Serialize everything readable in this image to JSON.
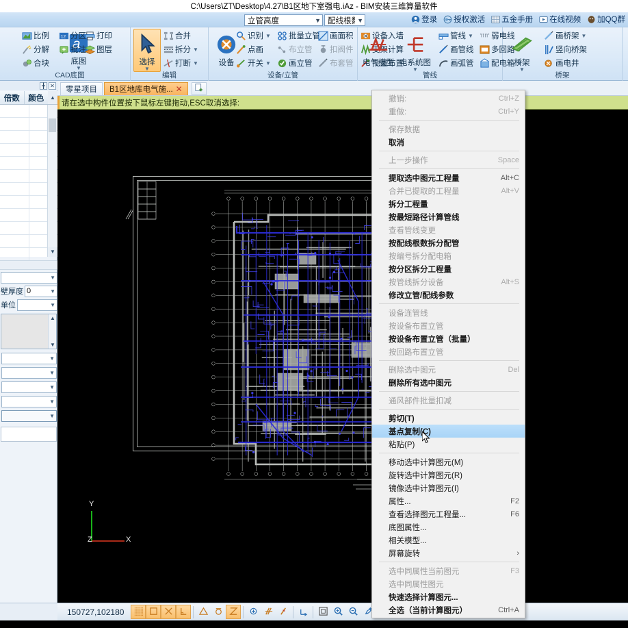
{
  "window": {
    "title": "C:\\Users\\ZT\\Desktop\\4.27\\B1区地下室强电.iAz - BIM安装三维算量软件"
  },
  "topbar": {
    "combos": [
      {
        "name": "pipe-height",
        "value": "立管高度"
      },
      {
        "name": "wire-count",
        "value": "配线根数"
      }
    ],
    "links": [
      {
        "icon": "user-icon",
        "label": "登录"
      },
      {
        "icon": "key-icon",
        "label": "授权激活"
      },
      {
        "icon": "book-icon",
        "label": "五金手册"
      },
      {
        "icon": "video-icon",
        "label": "在线视频"
      },
      {
        "icon": "qq-icon",
        "label": "加QQ群"
      }
    ]
  },
  "ribbon": {
    "groups": [
      {
        "name": "cad-base",
        "label": "CAD底图",
        "items": [
          {
            "label": "比例",
            "icon": "scale-icon",
            "dropdown": false,
            "disabled": false
          },
          {
            "label": "分区",
            "icon": "zone-icon",
            "dropdown": true,
            "disabled": false
          },
          {
            "label": "分解",
            "icon": "explode-icon",
            "dropdown": false,
            "disabled": false
          },
          {
            "label": "批注",
            "icon": "note-icon",
            "dropdown": true,
            "disabled": false
          },
          {
            "label": "合块",
            "icon": "merge-icon",
            "dropdown": false,
            "disabled": false
          },
          {
            "label": "打印",
            "icon": "print-icon",
            "dropdown": false,
            "disabled": false
          },
          {
            "label": "图层",
            "icon": "layer-icon",
            "dropdown": false,
            "disabled": false
          }
        ],
        "bigbuttons": [
          {
            "label": "底图",
            "icon": "basemap-icon",
            "dropdown": true,
            "selected": false
          }
        ]
      },
      {
        "name": "edit",
        "label": "编辑",
        "items": [
          {
            "label": "合并",
            "icon": "combine-icon",
            "dropdown": false,
            "disabled": false
          },
          {
            "label": "拆分",
            "icon": "split-icon",
            "dropdown": true,
            "disabled": false
          },
          {
            "label": "打断",
            "icon": "break-icon",
            "dropdown": true,
            "disabled": false
          }
        ],
        "bigbuttons": [
          {
            "label": "选择",
            "icon": "select-arrow-icon",
            "dropdown": true,
            "selected": true
          }
        ]
      },
      {
        "name": "device-riser",
        "label": "设备/立管",
        "items": [
          {
            "label": "识别",
            "icon": "recognize-icon",
            "dropdown": true,
            "disabled": false
          },
          {
            "label": "点画",
            "icon": "pointdraw-icon",
            "dropdown": false,
            "disabled": false
          },
          {
            "label": "开关",
            "icon": "switch-icon",
            "dropdown": true,
            "disabled": false
          },
          {
            "label": "批量立管",
            "icon": "batch-riser-icon",
            "dropdown": true,
            "disabled": false
          },
          {
            "label": "布立管",
            "icon": "layout-riser-icon",
            "dropdown": false,
            "disabled": true
          },
          {
            "label": "画立管",
            "icon": "draw-riser-icon",
            "dropdown": false,
            "disabled": false
          },
          {
            "label": "画面积",
            "icon": "area-icon",
            "dropdown": false,
            "disabled": false
          },
          {
            "label": "扣阀件",
            "icon": "valve-icon",
            "dropdown": false,
            "disabled": true
          },
          {
            "label": "布套管",
            "icon": "sleeve-icon",
            "dropdown": false,
            "disabled": true
          },
          {
            "label": "设备入墙",
            "icon": "wall-device-icon",
            "dropdown": false,
            "disabled": false
          },
          {
            "label": "支架计算",
            "icon": "bracket-icon",
            "dropdown": false,
            "disabled": false
          },
          {
            "label": "批量布置",
            "icon": "batch-layout-icon",
            "dropdown": false,
            "disabled": false
          }
        ],
        "bigbuttons": [
          {
            "label": "设备",
            "icon": "device-icon",
            "dropdown": false,
            "selected": false
          }
        ]
      },
      {
        "name": "pipeline",
        "label": "管线",
        "items": [
          {
            "label": "管线",
            "icon": "pipe-icon",
            "dropdown": true,
            "disabled": false
          },
          {
            "label": "画管线",
            "icon": "draw-pipe-icon",
            "dropdown": false,
            "disabled": false
          },
          {
            "label": "画弧管",
            "icon": "arc-pipe-icon",
            "dropdown": false,
            "disabled": false
          },
          {
            "label": "弱电线",
            "icon": "weak-wire-icon",
            "dropdown": false,
            "disabled": false
          },
          {
            "label": "多回路",
            "icon": "loops-icon",
            "dropdown": true,
            "disabled": false
          },
          {
            "label": "配电箱",
            "icon": "panel-icon",
            "dropdown": true,
            "disabled": false
          }
        ],
        "bigbuttons": [
          {
            "label": "电气模型",
            "icon": "elec-model-icon",
            "dropdown": false,
            "selected": false
          },
          {
            "label": "电系统图",
            "icon": "elec-system-icon",
            "dropdown": true,
            "selected": false
          }
        ]
      },
      {
        "name": "tray",
        "label": "桥架",
        "items": [
          {
            "label": "画桥架",
            "icon": "draw-tray-icon",
            "dropdown": true,
            "disabled": false
          },
          {
            "label": "竖向桥架",
            "icon": "vertical-tray-icon",
            "dropdown": false,
            "disabled": false
          },
          {
            "label": "画电井",
            "icon": "shaft-icon",
            "dropdown": false,
            "disabled": false
          }
        ],
        "bigbuttons": [
          {
            "label": "桥架",
            "icon": "tray-icon",
            "dropdown": true,
            "selected": false
          }
        ]
      }
    ]
  },
  "left_panel": {
    "grid": {
      "columns": [
        "倍数",
        "颜色"
      ],
      "rows": 12
    },
    "properties": [
      {
        "label": "",
        "value": ""
      },
      {
        "label": "壁厚度",
        "value": "0"
      },
      {
        "label": "单位",
        "value": ""
      }
    ],
    "extra_fields": [
      "",
      "",
      "",
      "",
      ""
    ]
  },
  "tabs": {
    "items": [
      {
        "label": "零星项目",
        "active": false,
        "closable": false
      },
      {
        "label": "B1区地库电气施...",
        "active": true,
        "closable": true
      }
    ],
    "new_tab_icon": "new-tab-icon"
  },
  "prompt": {
    "text": "请在选中构件位置按下鼠标左键拖动,ESC取消选择:"
  },
  "canvas": {
    "axes": {
      "x": "X",
      "y": "Y",
      "z": "Z"
    },
    "colors": {
      "background": "#000000",
      "drawing": "#b9bcb9",
      "wiring": "#2a2ad0",
      "axis_y": "#19b319",
      "axis_x": "#b32019"
    }
  },
  "status_bar": {
    "coordinates": "150727,102180",
    "buttons": [
      {
        "name": "grid-snap-icon",
        "on": true
      },
      {
        "name": "ortho-icon",
        "on": true
      },
      {
        "name": "osnap-cross-icon",
        "on": true
      },
      {
        "name": "polar-icon",
        "on": true
      },
      {
        "name": "triangle-snap-icon",
        "on": false
      },
      {
        "name": "circle-snap-icon",
        "on": false
      },
      {
        "name": "hourglass-snap-icon",
        "on": true
      },
      {
        "name": "node-snap-icon",
        "on": false
      },
      {
        "name": "parallel-icon",
        "on": false
      },
      {
        "name": "perp-icon",
        "on": false
      },
      {
        "name": "ucs-icon",
        "on": false
      },
      {
        "name": "zoom-extents-icon",
        "on": false
      },
      {
        "name": "zoom-in-icon",
        "on": false
      },
      {
        "name": "zoom-out-icon",
        "on": false
      },
      {
        "name": "pan-icon",
        "on": false
      },
      {
        "name": "window-icon",
        "on": false
      },
      {
        "name": "measure-icon",
        "on": false
      }
    ]
  },
  "context_menu": {
    "items": [
      {
        "label": "撤销:",
        "shortcut": "Ctrl+Z",
        "state": "disabled"
      },
      {
        "label": "重做:",
        "shortcut": "Ctrl+Y",
        "state": "disabled"
      },
      {
        "type": "separator"
      },
      {
        "label": "保存数据",
        "shortcut": "",
        "state": "disabled"
      },
      {
        "label": "取消",
        "shortcut": "",
        "state": "bold"
      },
      {
        "type": "separator"
      },
      {
        "label": "上一步操作",
        "shortcut": "Space",
        "state": "disabled"
      },
      {
        "type": "separator"
      },
      {
        "label": "提取选中图元工程量",
        "shortcut": "Alt+C",
        "state": "bold"
      },
      {
        "label": "合并已提取的工程量",
        "shortcut": "Alt+V",
        "state": "disabled"
      },
      {
        "label": "拆分工程量",
        "shortcut": "",
        "state": "bold"
      },
      {
        "label": "按最短路径计算管线",
        "shortcut": "",
        "state": "bold"
      },
      {
        "label": "查看管线变更",
        "shortcut": "",
        "state": "disabled"
      },
      {
        "label": "按配线根数拆分配管",
        "shortcut": "",
        "state": "bold"
      },
      {
        "label": "按编号拆分配电箱",
        "shortcut": "",
        "state": "disabled"
      },
      {
        "label": "按分区拆分工程量",
        "shortcut": "",
        "state": "bold"
      },
      {
        "label": "按管线拆分设备",
        "shortcut": "Alt+S",
        "state": "disabled"
      },
      {
        "label": "修改立管/配线参数",
        "shortcut": "",
        "state": "bold"
      },
      {
        "type": "separator"
      },
      {
        "label": "设备连管线",
        "shortcut": "",
        "state": "disabled"
      },
      {
        "label": "按设备布置立管",
        "shortcut": "",
        "state": "disabled"
      },
      {
        "label": "按设备布置立管（批量）",
        "shortcut": "",
        "state": "bold"
      },
      {
        "label": "按回路布置立管",
        "shortcut": "",
        "state": "disabled"
      },
      {
        "type": "separator"
      },
      {
        "label": "删除选中图元",
        "shortcut": "Del",
        "state": "disabled"
      },
      {
        "label": "删除所有选中图元",
        "shortcut": "",
        "state": "bold"
      },
      {
        "type": "separator"
      },
      {
        "label": "通风部件批量扣减",
        "shortcut": "",
        "state": "disabled"
      },
      {
        "type": "separator"
      },
      {
        "label": "剪切(T)",
        "shortcut": "",
        "state": "bold"
      },
      {
        "label": "基点复制(C)",
        "shortcut": "",
        "state": "highlighted"
      },
      {
        "label": "粘贴(P)",
        "shortcut": "",
        "state": "normal"
      },
      {
        "type": "separator"
      },
      {
        "label": "移动选中计算图元(M)",
        "shortcut": "",
        "state": "normal"
      },
      {
        "label": "旋转选中计算图元(R)",
        "shortcut": "",
        "state": "normal"
      },
      {
        "label": "镜像选中计算图元(I)",
        "shortcut": "",
        "state": "normal"
      },
      {
        "label": "属性...",
        "shortcut": "F2",
        "state": "normal"
      },
      {
        "label": "查看选择图元工程量...",
        "shortcut": "F6",
        "state": "normal"
      },
      {
        "label": "底图属性...",
        "shortcut": "",
        "state": "normal"
      },
      {
        "label": "相关模型...",
        "shortcut": "",
        "state": "normal"
      },
      {
        "label": "屏幕旋转",
        "shortcut": "",
        "state": "normal",
        "submenu": true
      },
      {
        "type": "separator"
      },
      {
        "label": "选中同属性当前图元",
        "shortcut": "F3",
        "state": "disabled"
      },
      {
        "label": "选中同属性图元",
        "shortcut": "",
        "state": "disabled"
      },
      {
        "label": "快速选择计算图元...",
        "shortcut": "",
        "state": "bold"
      },
      {
        "label": "全选（当前计算图元）",
        "shortcut": "Ctrl+A",
        "state": "bold"
      }
    ]
  }
}
